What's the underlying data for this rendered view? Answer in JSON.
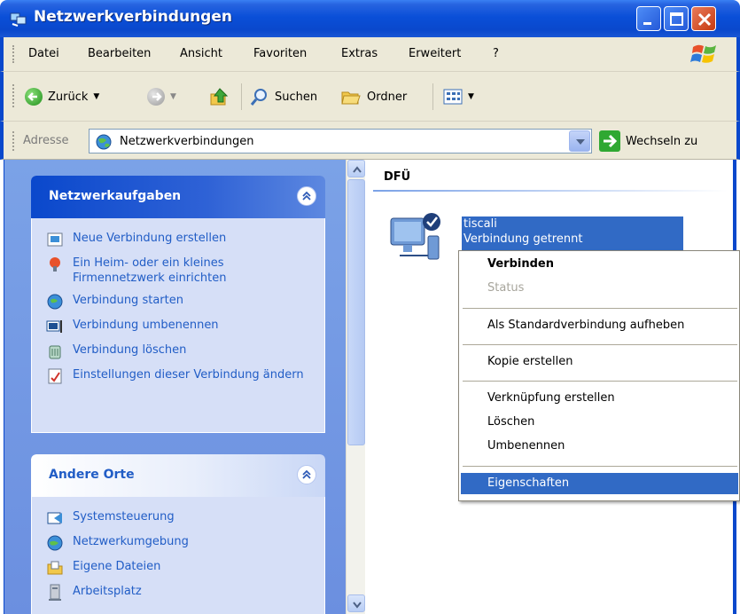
{
  "window": {
    "title": "Netzwerkverbindungen"
  },
  "menubar": {
    "items": [
      "Datei",
      "Bearbeiten",
      "Ansicht",
      "Favoriten",
      "Extras",
      "Erweitert",
      "?"
    ]
  },
  "toolbar": {
    "back_label": "Zurück",
    "search_label": "Suchen",
    "folders_label": "Ordner"
  },
  "address": {
    "label": "Adresse",
    "value": "Netzwerkverbindungen",
    "go_label": "Wechseln zu"
  },
  "sidebar": {
    "tasks": {
      "title": "Netzwerkaufgaben",
      "items": [
        {
          "label": "Neue Verbindung erstellen",
          "icon": "new-connection-icon"
        },
        {
          "label": "Ein Heim- oder ein kleines Firmennetzwerk einrichten",
          "icon": "home-network-icon"
        },
        {
          "label": "Verbindung starten",
          "icon": "connect-icon"
        },
        {
          "label": "Verbindung umbenennen",
          "icon": "rename-icon"
        },
        {
          "label": "Verbindung löschen",
          "icon": "delete-icon"
        },
        {
          "label": "Einstellungen dieser Verbindung ändern",
          "icon": "settings-icon"
        }
      ]
    },
    "places": {
      "title": "Andere Orte",
      "items": [
        {
          "label": "Systemsteuerung",
          "icon": "control-panel-icon"
        },
        {
          "label": "Netzwerkumgebung",
          "icon": "network-places-icon"
        },
        {
          "label": "Eigene Dateien",
          "icon": "my-documents-icon"
        },
        {
          "label": "Arbeitsplatz",
          "icon": "my-computer-icon"
        }
      ]
    }
  },
  "content": {
    "group_title": "DFÜ",
    "connection": {
      "name": "tiscali",
      "status": "Verbindung getrennt"
    }
  },
  "context_menu": {
    "items": [
      {
        "label": "Verbinden",
        "style": "bold"
      },
      {
        "label": "Status",
        "style": "disabled"
      },
      {
        "label": "Als Standardverbindung aufheben",
        "style": "normal"
      },
      {
        "label": "Kopie erstellen",
        "style": "normal"
      },
      {
        "label": "Verknüpfung erstellen",
        "style": "normal"
      },
      {
        "label": "Löschen",
        "style": "normal"
      },
      {
        "label": "Umbenennen",
        "style": "normal"
      },
      {
        "label": "Eigenschaften",
        "style": "highlighted"
      }
    ]
  },
  "colors": {
    "titlebar": "#0a48cc",
    "selection": "#316ac5",
    "task_link": "#215dc6",
    "sidebar_bg": "#7ba2e7"
  }
}
